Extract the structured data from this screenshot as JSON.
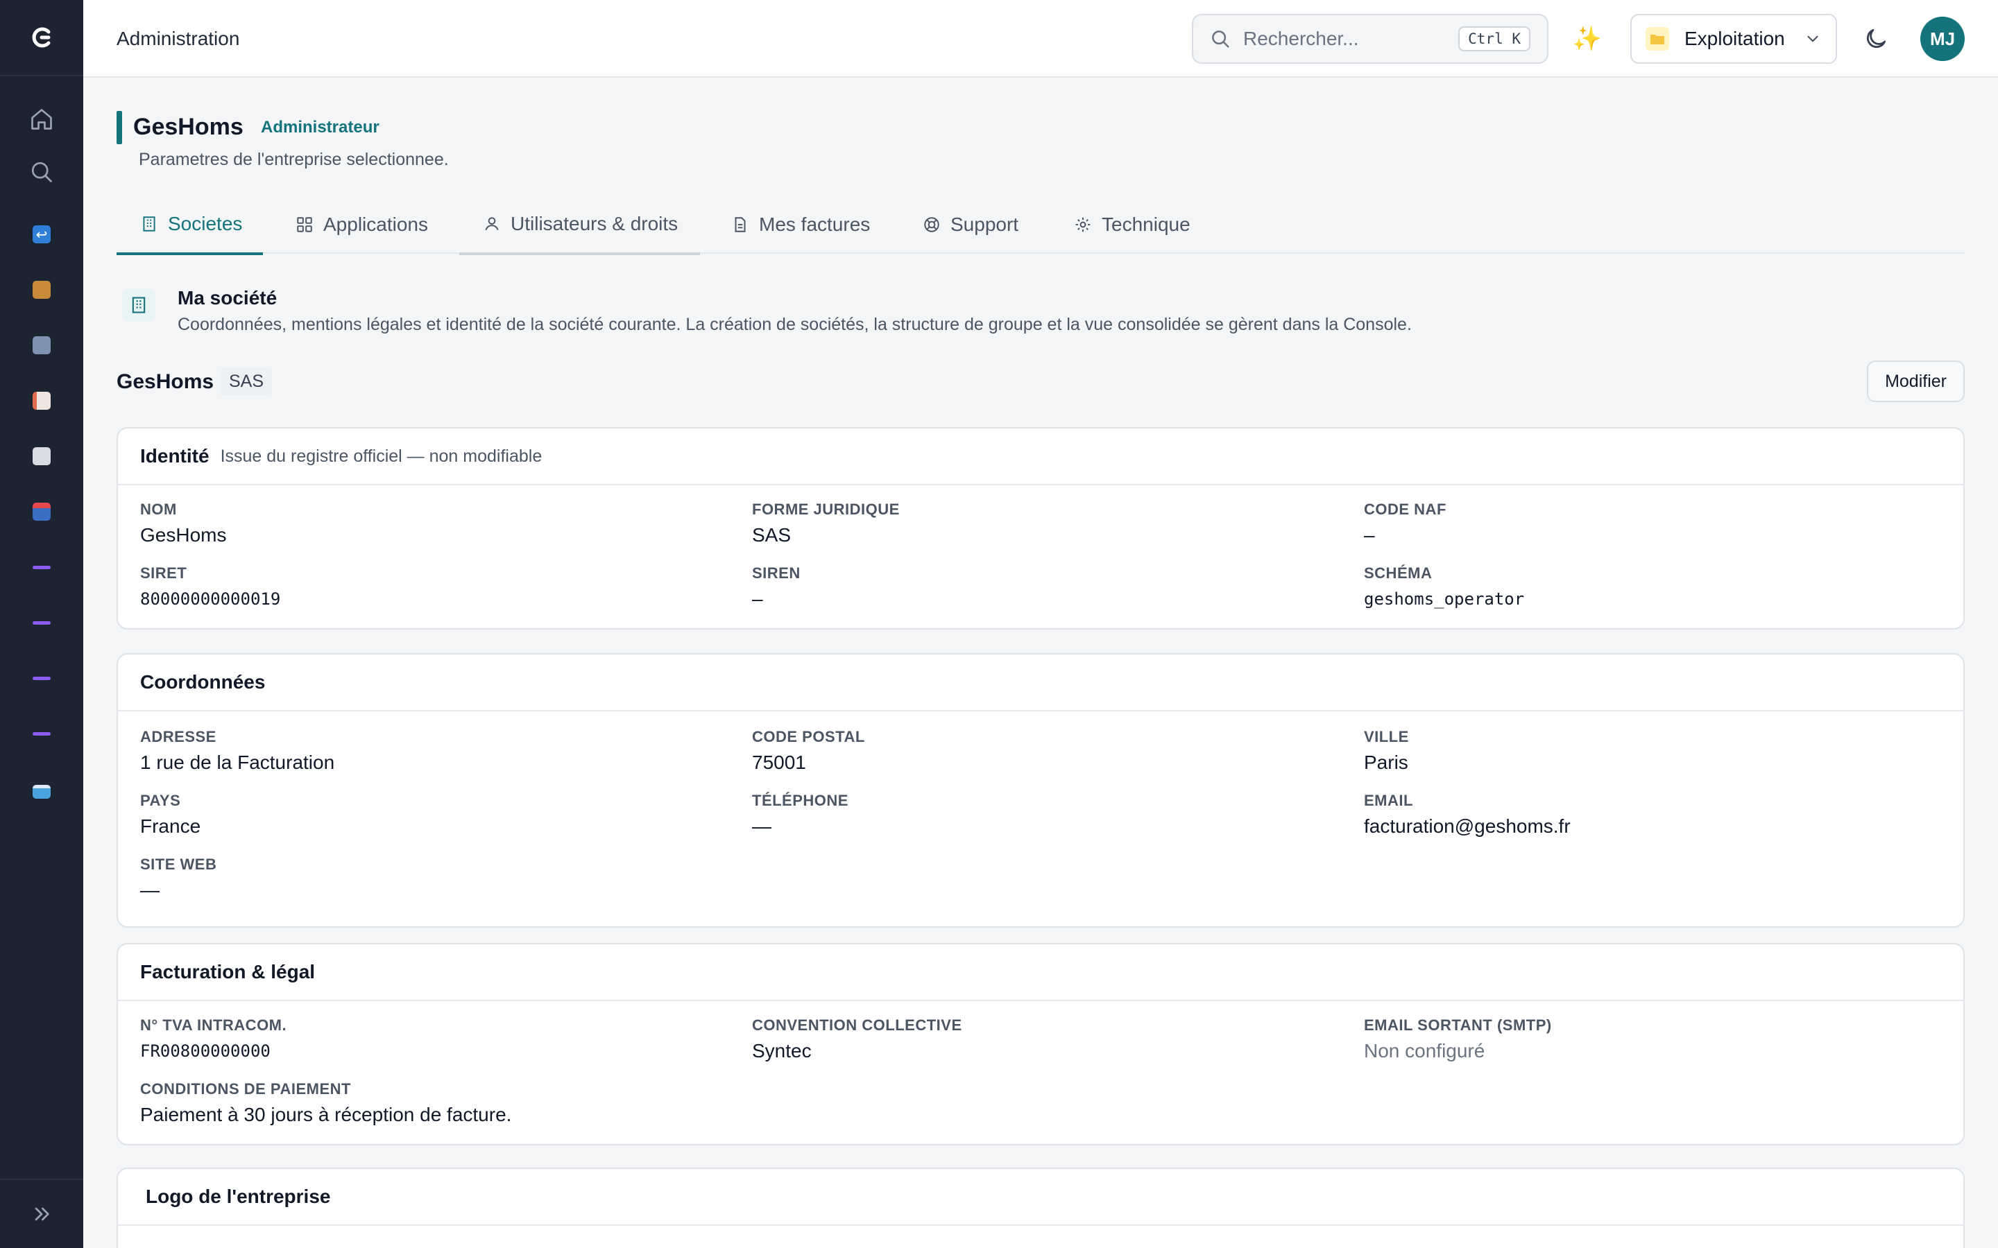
{
  "app": {
    "section_title": "Administration"
  },
  "search": {
    "placeholder": "Rechercher...",
    "shortcut": "Ctrl K"
  },
  "context": {
    "label": "Exploitation"
  },
  "user": {
    "initials": "MJ"
  },
  "colors": {
    "accent": "#14737b",
    "sidebar": "#1c2331",
    "sidebar_dash": "#8b5cf6"
  },
  "page": {
    "title": "GesHoms",
    "role": "Administrateur",
    "subtitle": "Parametres de l'entreprise selectionnee."
  },
  "tabs": [
    {
      "label": "Societes",
      "icon": "building-icon",
      "active": true
    },
    {
      "label": "Applications",
      "icon": "grid-icon"
    },
    {
      "label": "Utilisateurs & droits",
      "icon": "users-icon"
    },
    {
      "label": "Mes factures",
      "icon": "document-icon"
    },
    {
      "label": "Support",
      "icon": "lifebuoy-icon"
    },
    {
      "label": "Technique",
      "icon": "gear-icon"
    }
  ],
  "section": {
    "title": "Ma société",
    "description": "Coordonnées, mentions légales et identité de la société courante. La création de sociétés, la structure de groupe et la vue consolidée se gèrent dans la Console."
  },
  "company": {
    "name": "GesHoms",
    "legal_form_tag": "SAS",
    "edit_label": "Modifier"
  },
  "identity": {
    "title": "Identité",
    "subtitle": "Issue du registre officiel — non modifiable",
    "fields": [
      {
        "label": "NOM",
        "value": "GesHoms"
      },
      {
        "label": "FORME JURIDIQUE",
        "value": "SAS"
      },
      {
        "label": "CODE NAF",
        "value": "–"
      },
      {
        "label": "SIRET",
        "value": "80000000000019"
      },
      {
        "label": "SIREN",
        "value": "–"
      },
      {
        "label": "SCHÉMA",
        "value": "geshoms_operator"
      }
    ]
  },
  "contact": {
    "title": "Coordonnées",
    "fields": [
      {
        "label": "ADRESSE",
        "value": "1 rue de la Facturation"
      },
      {
        "label": "CODE POSTAL",
        "value": "75001"
      },
      {
        "label": "VILLE",
        "value": "Paris"
      },
      {
        "label": "PAYS",
        "value": "France"
      },
      {
        "label": "TÉLÉPHONE",
        "value": "—"
      },
      {
        "label": "EMAIL",
        "value": "facturation@geshoms.fr"
      },
      {
        "label": "SITE WEB",
        "value": "—"
      }
    ]
  },
  "billing": {
    "title": "Facturation & légal",
    "fields": [
      {
        "label": "N° TVA INTRACOM.",
        "value": "FR00800000000"
      },
      {
        "label": "CONVENTION COLLECTIVE",
        "value": "Syntec"
      },
      {
        "label": "EMAIL SORTANT (SMTP)",
        "value": "Non configuré"
      },
      {
        "label": "CONDITIONS DE PAIEMENT",
        "value": "Paiement à 30 jours à réception de facture."
      }
    ]
  },
  "logo_card": {
    "title": "Logo de l'entreprise"
  }
}
